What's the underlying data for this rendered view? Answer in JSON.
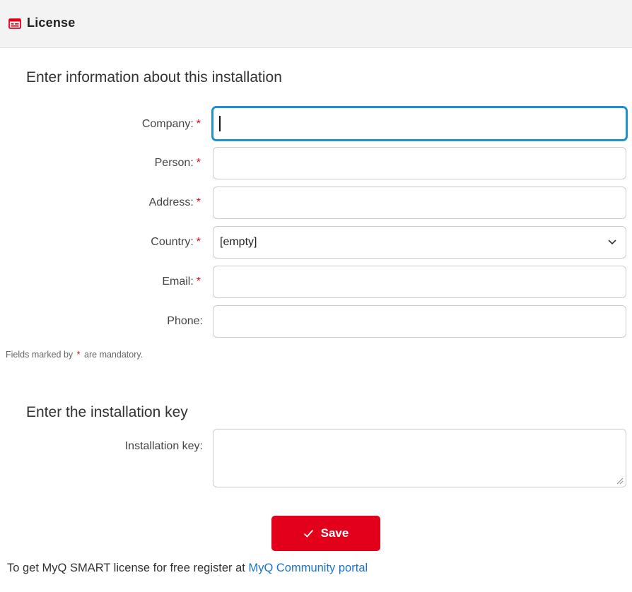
{
  "header": {
    "title": "License",
    "icon": "license-card-icon",
    "icon_color": "#e2001a"
  },
  "installation_info": {
    "title": "Enter information about this installation",
    "required_marker": "*",
    "fields": [
      {
        "label": "Company:",
        "required": true,
        "value": ""
      },
      {
        "label": "Person:",
        "required": true,
        "value": ""
      },
      {
        "label": "Address:",
        "required": true,
        "value": ""
      },
      {
        "label": "Country:",
        "required": true,
        "value": "[empty]"
      },
      {
        "label": "Email:",
        "required": true,
        "value": ""
      },
      {
        "label": "Phone:",
        "required": false,
        "value": ""
      }
    ],
    "note_prefix": "Fields marked by",
    "note_suffix": "are mandatory."
  },
  "installation_key": {
    "title": "Enter the installation key",
    "label": "Installation key:",
    "value": ""
  },
  "save_button": {
    "label": "Save",
    "icon": "check-icon",
    "color": "#e2001a"
  },
  "footer": {
    "text": "To get MyQ SMART license for free register at",
    "link_text": "MyQ Community portal",
    "link_color": "#1a73c9"
  },
  "colors": {
    "accent_focus": "#1f8fd6",
    "required": "#d0021b"
  }
}
